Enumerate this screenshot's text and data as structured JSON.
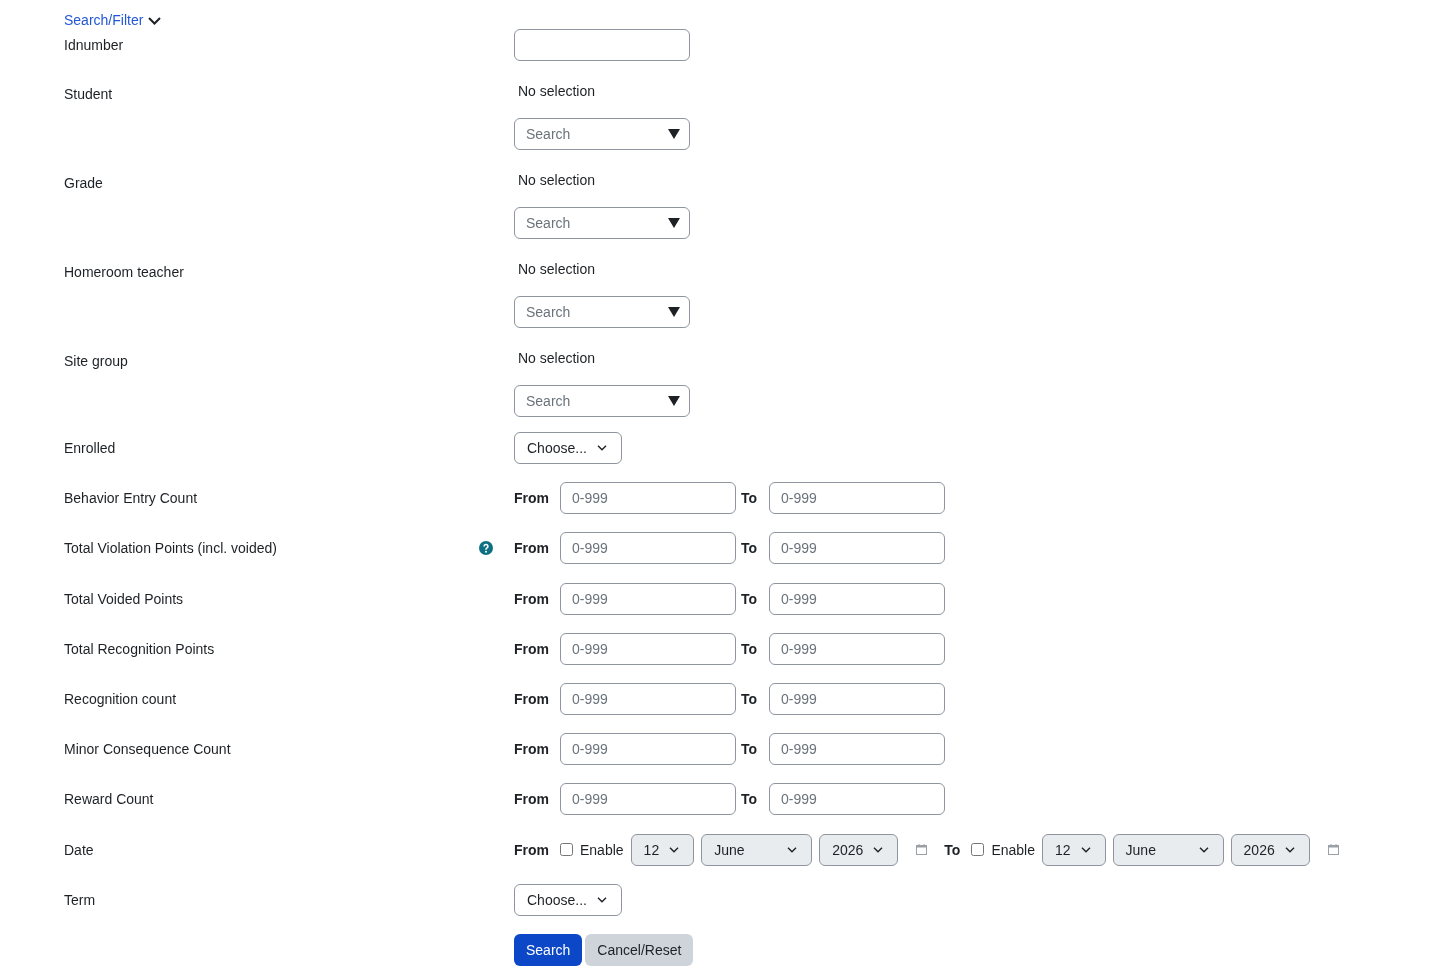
{
  "header": {
    "link": "Search/Filter",
    "expanded": true
  },
  "fields": [
    {
      "kind": "text",
      "label": "Idnumber",
      "help": false
    },
    {
      "kind": "autocomplete",
      "label": "Student",
      "help": false,
      "selection": "No selection",
      "placeholder": "Search"
    },
    {
      "kind": "autocomplete",
      "label": "Grade",
      "help": false,
      "selection": "No selection",
      "placeholder": "Search"
    },
    {
      "kind": "autocomplete",
      "label": "Homeroom teacher",
      "help": false,
      "selection": "No selection",
      "placeholder": "Search"
    },
    {
      "kind": "autocomplete",
      "label": "Site group",
      "help": false,
      "selection": "No selection",
      "placeholder": "Search"
    },
    {
      "kind": "select",
      "label": "Enrolled",
      "help": false,
      "value": "Choose..."
    },
    {
      "kind": "range",
      "label": "Behavior Entry Count",
      "help": false,
      "from": {
        "label": "From",
        "placeholder": "0-999"
      },
      "to": {
        "label": "To",
        "placeholder": "0-999"
      }
    },
    {
      "kind": "range",
      "label": "Total Violation Points (incl. voided)",
      "help": true,
      "from": {
        "label": "From",
        "placeholder": "0-999"
      },
      "to": {
        "label": "To",
        "placeholder": "0-999"
      }
    },
    {
      "kind": "range",
      "label": "Total Voided Points",
      "help": false,
      "from": {
        "label": "From",
        "placeholder": "0-999"
      },
      "to": {
        "label": "To",
        "placeholder": "0-999"
      }
    },
    {
      "kind": "range",
      "label": "Total Recognition Points",
      "help": false,
      "from": {
        "label": "From",
        "placeholder": "0-999"
      },
      "to": {
        "label": "To",
        "placeholder": "0-999"
      }
    },
    {
      "kind": "range",
      "label": "Recognition count",
      "help": false,
      "from": {
        "label": "From",
        "placeholder": "0-999"
      },
      "to": {
        "label": "To",
        "placeholder": "0-999"
      }
    },
    {
      "kind": "range",
      "label": "Minor Consequence Count",
      "help": false,
      "from": {
        "label": "From",
        "placeholder": "0-999"
      },
      "to": {
        "label": "To",
        "placeholder": "0-999"
      }
    },
    {
      "kind": "range",
      "label": "Reward Count",
      "help": false,
      "from": {
        "label": "From",
        "placeholder": "0-999"
      },
      "to": {
        "label": "To",
        "placeholder": "0-999"
      }
    },
    {
      "kind": "date",
      "label": "Date",
      "help": false,
      "from": {
        "label": "From",
        "enable_label": "Enable",
        "enabled": false,
        "day": "12",
        "month": "June",
        "year": "2026"
      },
      "to": {
        "label": "To",
        "enable_label": "Enable",
        "enabled": false,
        "day": "12",
        "month": "June",
        "year": "2026"
      }
    },
    {
      "kind": "select",
      "label": "Term",
      "help": false,
      "value": "Choose..."
    }
  ],
  "buttons": [
    {
      "label": "Search",
      "kind": "primary"
    },
    {
      "label": "Cancel/Reset",
      "kind": "secondary"
    }
  ]
}
